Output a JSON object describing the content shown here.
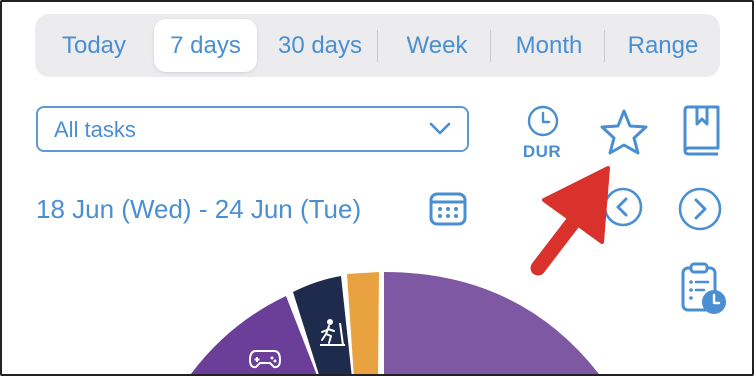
{
  "period_tabs": [
    {
      "label": "Today",
      "active": false
    },
    {
      "label": "7 days",
      "active": true
    },
    {
      "label": "30 days",
      "active": false
    },
    {
      "label": "Week",
      "active": false
    },
    {
      "label": "Month",
      "active": false
    },
    {
      "label": "Range",
      "active": false
    }
  ],
  "filter": {
    "selected": "All tasks"
  },
  "toolbar": {
    "duration_label": "DUR"
  },
  "date_range": "18 Jun (Wed) - 24 Jun (Tue)",
  "icons": {
    "clock": "clock-icon",
    "star": "star-icon",
    "bookmark_book": "book-icon",
    "calendar": "calendar-icon",
    "prev": "chevron-left-icon",
    "next": "chevron-right-icon",
    "clipboard": "clipboard-clock-icon",
    "arrow": "red-arrow-annotation"
  },
  "colors": {
    "accent": "#4a8fd1",
    "arrow": "#d9312b",
    "segment_purple_light": "#7e58a2",
    "segment_purple": "#6a3e99",
    "segment_navy": "#1f2b4c",
    "segment_orange": "#e9a240"
  }
}
